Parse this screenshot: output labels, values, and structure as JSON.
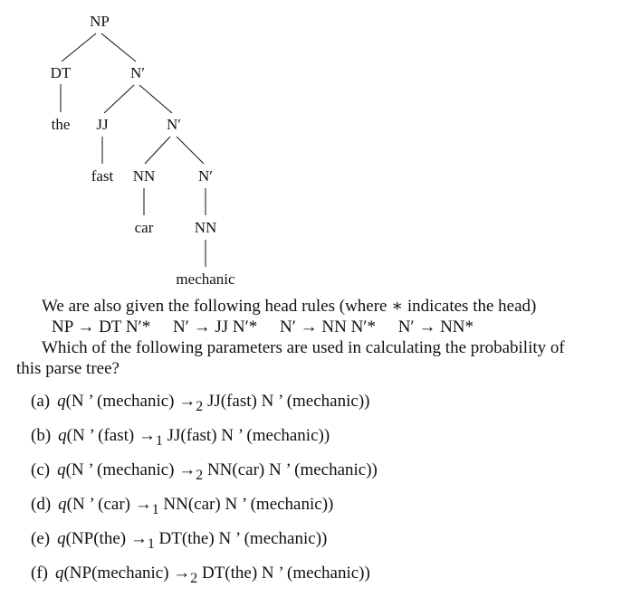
{
  "tree": {
    "labels": {
      "np": "NP",
      "dt": "DT",
      "n1": "N′",
      "the": "the",
      "jj": "JJ",
      "n2": "N′",
      "fast": "fast",
      "nn1": "NN",
      "n3": "N′",
      "car": "car",
      "nn2": "NN",
      "mechanic": "mechanic"
    }
  },
  "text": {
    "intro": "We are also given the following head rules (where ∗ indicates the head)",
    "rules": [
      "NP → DT N′*",
      "N′ → JJ N′*",
      "N′ → NN N′*",
      "N′ → NN*"
    ],
    "question_line1": "Which of the following parameters are used in calculating the probability of",
    "question_line2": "this parse tree?"
  },
  "options": [
    {
      "label": "(a)",
      "q": "q",
      "lhs": "(N ’ (mechanic) →",
      "sub": "2",
      "rhs": " JJ(fast) N ’ (mechanic))"
    },
    {
      "label": "(b)",
      "q": "q",
      "lhs": "(N ’ (fast) →",
      "sub": "1",
      "rhs": " JJ(fast) N ’ (mechanic))"
    },
    {
      "label": "(c)",
      "q": "q",
      "lhs": "(N ’ (mechanic) →",
      "sub": "2",
      "rhs": " NN(car) N ’ (mechanic))"
    },
    {
      "label": "(d)",
      "q": "q",
      "lhs": "(N ’ (car) →",
      "sub": "1",
      "rhs": " NN(car) N ’ (mechanic))"
    },
    {
      "label": "(e)",
      "q": "q",
      "lhs": "(NP(the) →",
      "sub": "1",
      "rhs": " DT(the) N ’ (mechanic))"
    },
    {
      "label": "(f)",
      "q": "q",
      "lhs": "(NP(mechanic) →",
      "sub": "2",
      "rhs": " DT(the) N ’ (mechanic))"
    }
  ]
}
